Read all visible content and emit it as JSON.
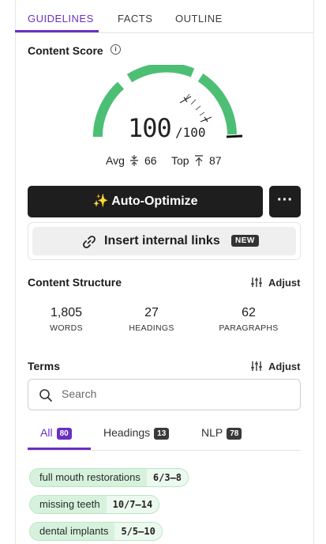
{
  "tabs": [
    {
      "label": "GUIDELINES",
      "active": true
    },
    {
      "label": "FACTS",
      "active": false
    },
    {
      "label": "OUTLINE",
      "active": false
    }
  ],
  "content_score": {
    "title": "Content Score",
    "score": "100",
    "max": "/100",
    "avg_label": "Avg",
    "avg_value": "66",
    "top_label": "Top",
    "top_value": "87"
  },
  "actions": {
    "auto_optimize": "✨ Auto-Optimize",
    "more": "···",
    "insert_links": "Insert internal links",
    "new_badge": "NEW"
  },
  "structure": {
    "title": "Content Structure",
    "adjust": "Adjust",
    "stats": [
      {
        "value": "1,805",
        "label": "WORDS"
      },
      {
        "value": "27",
        "label": "HEADINGS"
      },
      {
        "value": "62",
        "label": "PARAGRAPHS"
      }
    ]
  },
  "terms": {
    "title": "Terms",
    "adjust": "Adjust",
    "search_placeholder": "Search",
    "filter_tabs": [
      {
        "label": "All",
        "count": "80",
        "active": true
      },
      {
        "label": "Headings",
        "count": "13",
        "active": false
      },
      {
        "label": "NLP",
        "count": "78",
        "active": false
      }
    ],
    "items": [
      {
        "name": "full mouth restorations",
        "count": "6/3–8"
      },
      {
        "name": "missing teeth",
        "count": "10/7–14"
      },
      {
        "name": "dental implants",
        "count": "5/5–10"
      }
    ]
  },
  "colors": {
    "accent": "#6b2fc0",
    "gauge_green": "#4cbf75",
    "dark_button": "#1e1e1e"
  }
}
